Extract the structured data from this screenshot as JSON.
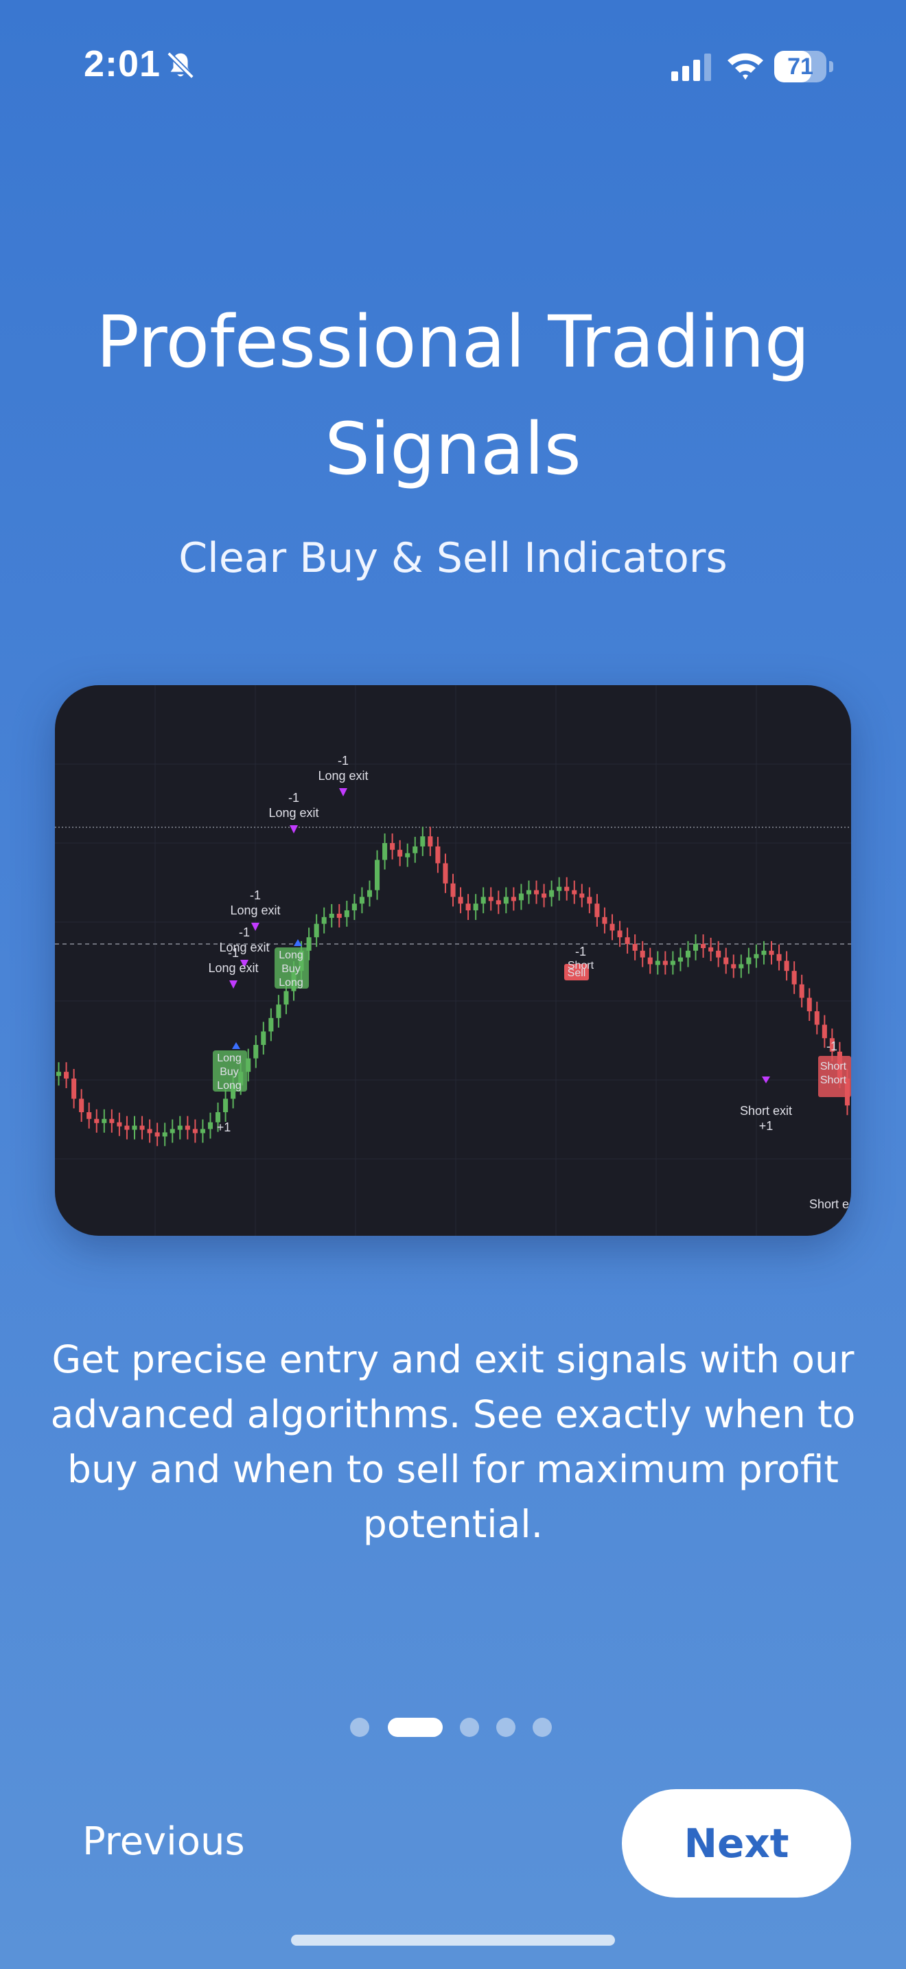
{
  "status_bar": {
    "time": "2:01",
    "battery": "71",
    "battery_level": 0.71
  },
  "onboarding": {
    "title": "Professional Trading Signals",
    "subtitle": "Clear Buy & Sell Indicators",
    "description": "Get precise entry and exit signals with our advanced algorithms. See exactly when to buy and when to sell for maximum profit potential.",
    "page_count": 5,
    "active_page": 1
  },
  "chart": {
    "labels": {
      "minus_one": "-1",
      "plus_one": "+1",
      "long_exit": "Long exit",
      "short_exit": "Short exit",
      "long": "Long",
      "short": "Short",
      "sell": "Sell",
      "buy": "Buy"
    }
  },
  "chart_data": {
    "type": "candlestick",
    "values": [
      0.32,
      0.3,
      0.24,
      0.2,
      0.18,
      0.17,
      0.18,
      0.17,
      0.16,
      0.15,
      0.16,
      0.15,
      0.14,
      0.13,
      0.14,
      0.15,
      0.16,
      0.15,
      0.14,
      0.15,
      0.17,
      0.2,
      0.24,
      0.28,
      0.32,
      0.36,
      0.4,
      0.44,
      0.48,
      0.52,
      0.56,
      0.62,
      0.68,
      0.72,
      0.76,
      0.78,
      0.79,
      0.78,
      0.8,
      0.82,
      0.84,
      0.86,
      0.95,
      1.0,
      0.98,
      0.96,
      0.97,
      0.99,
      1.02,
      0.99,
      0.94,
      0.88,
      0.84,
      0.82,
      0.8,
      0.82,
      0.84,
      0.83,
      0.82,
      0.84,
      0.83,
      0.85,
      0.86,
      0.85,
      0.84,
      0.86,
      0.87,
      0.86,
      0.85,
      0.84,
      0.82,
      0.78,
      0.76,
      0.74,
      0.72,
      0.7,
      0.68,
      0.66,
      0.64,
      0.65,
      0.64,
      0.65,
      0.66,
      0.68,
      0.7,
      0.69,
      0.68,
      0.66,
      0.64,
      0.63,
      0.64,
      0.66,
      0.67,
      0.68,
      0.67,
      0.65,
      0.62,
      0.58,
      0.54,
      0.5,
      0.46,
      0.42,
      0.38,
      0.3,
      0.22
    ]
  },
  "nav": {
    "previous_label": "Previous",
    "next_label": "Next"
  },
  "colors": {
    "accent": "#2e68c4",
    "up_candle": "#5db55d",
    "down_candle": "#e2555a",
    "signal_purple": "#c23bff",
    "signal_blue": "#3b6fff"
  }
}
